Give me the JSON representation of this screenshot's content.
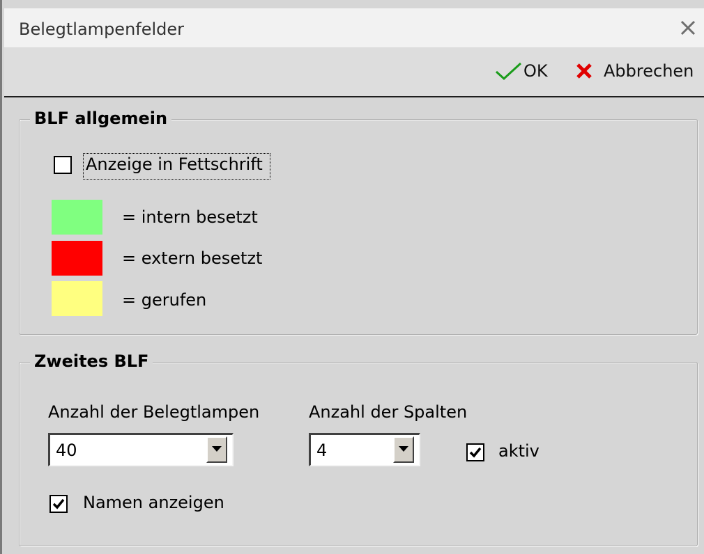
{
  "window": {
    "title": "Belegtlampenfelder"
  },
  "toolbar": {
    "ok_label": "OK",
    "cancel_label": "Abbrechen"
  },
  "blf_general": {
    "title": "BLF allgemein",
    "bold_checkbox": {
      "label": "Anzeige in Fettschrift",
      "checked": false
    },
    "legend_items": [
      {
        "color": "#80ff80",
        "label": "= intern besetzt"
      },
      {
        "color": "#ff0000",
        "label": "= extern besetzt"
      },
      {
        "color": "#ffff80",
        "label": "= gerufen"
      }
    ]
  },
  "second_blf": {
    "title": "Zweites BLF",
    "lamps_label": "Anzahl der Belegtlampen",
    "lamps_value": "40",
    "columns_label": "Anzahl der Spalten",
    "columns_value": "4",
    "active_label": "aktiv",
    "active_checked": true,
    "names_label": "Namen anzeigen",
    "names_checked": true
  },
  "colors": {
    "ok_check": "#1a9c1a",
    "cancel_x": "#e00000"
  }
}
